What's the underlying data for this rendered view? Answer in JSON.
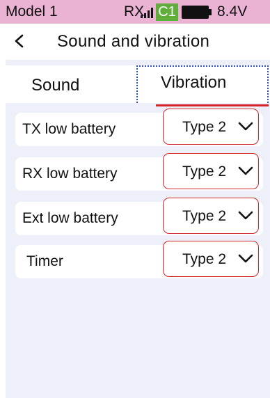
{
  "status_bar": {
    "model": "Model 1",
    "rx": "RX",
    "signal_icon": "signal-bars-icon",
    "channel_badge": "C1",
    "battery_icon": "battery-icon",
    "voltage": "8.4V",
    "colors": {
      "bar": "#eab2d3",
      "badge": "#5fae3a"
    }
  },
  "header": {
    "back_icon": "chevron-left-icon",
    "title": "Sound and vibration"
  },
  "tabs": [
    {
      "label": "Sound",
      "selected": false
    },
    {
      "label": "Vibration",
      "selected": true
    }
  ],
  "rows": [
    {
      "label": "TX low battery",
      "value": "Type 2"
    },
    {
      "label": "RX low battery",
      "value": "Type 2"
    },
    {
      "label": "Ext low battery",
      "value": "Type 2"
    },
    {
      "label": "Timer",
      "value": "Type 2"
    }
  ],
  "dropdown_icon": "chevron-down-icon",
  "accent_color": "#d6232a"
}
